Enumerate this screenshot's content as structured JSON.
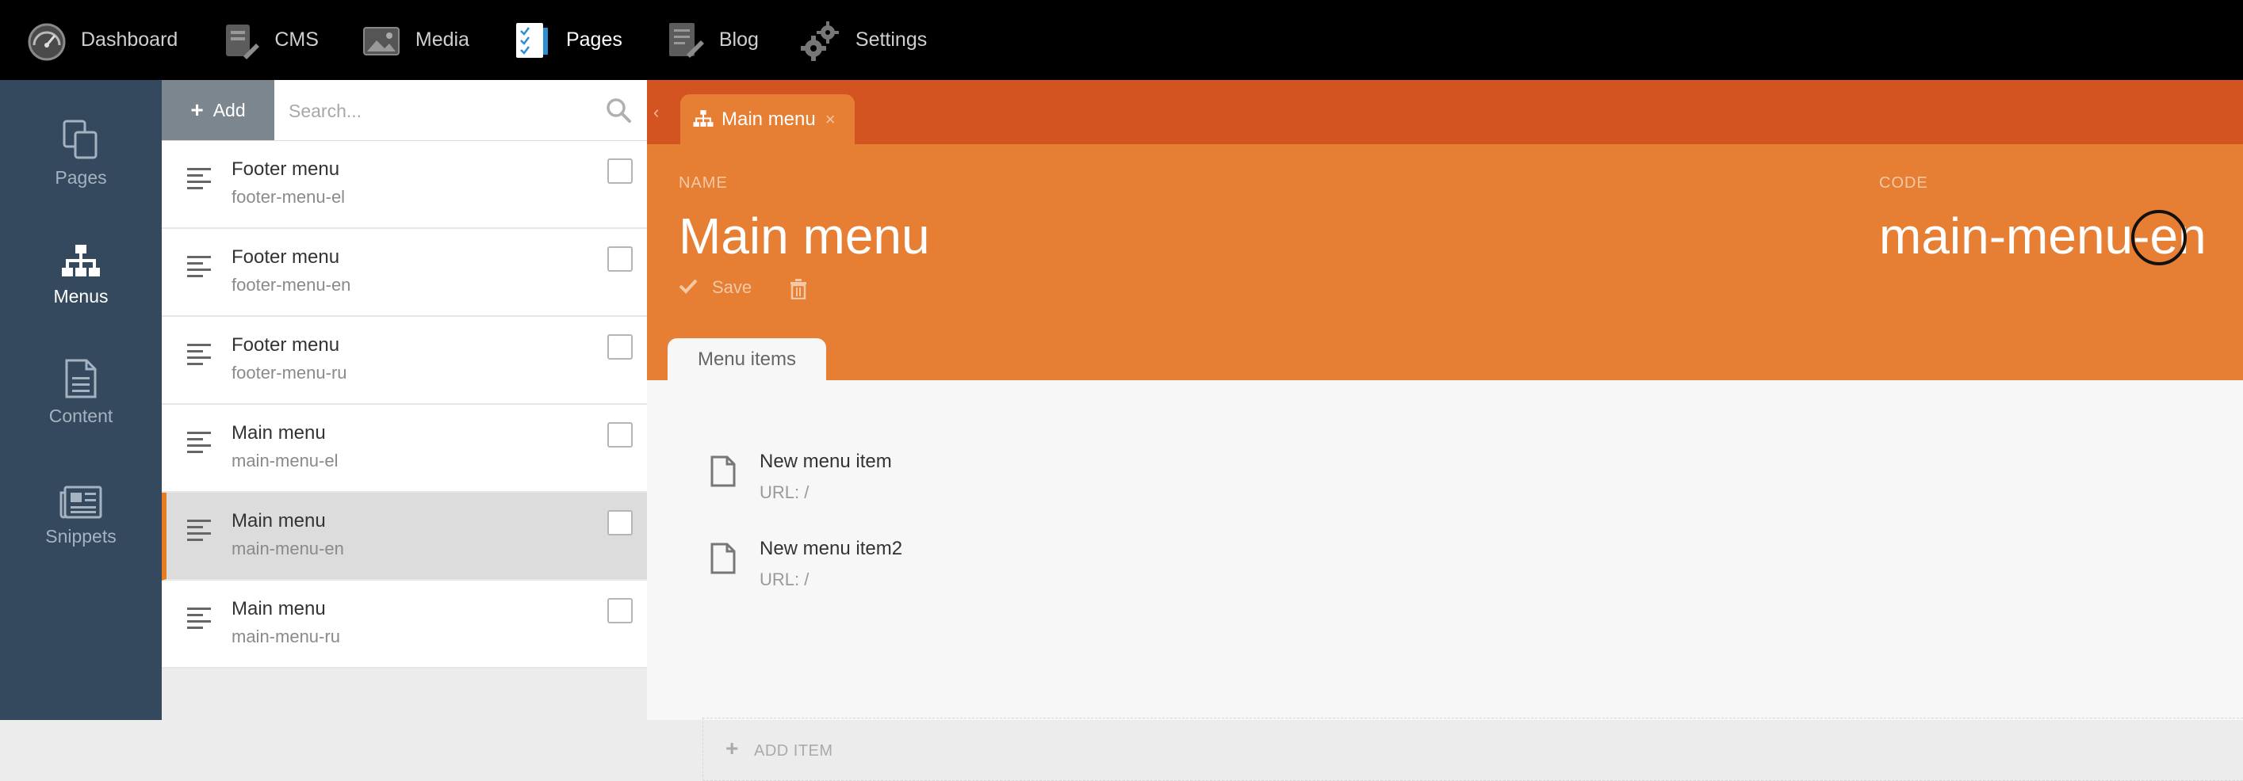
{
  "topnav": {
    "items": [
      {
        "label": "Dashboard",
        "icon": "dashboard-gauge-icon"
      },
      {
        "label": "CMS",
        "icon": "cms-icon"
      },
      {
        "label": "Media",
        "icon": "media-icon"
      },
      {
        "label": "Pages",
        "icon": "pages-icon",
        "active": true
      },
      {
        "label": "Blog",
        "icon": "blog-icon"
      },
      {
        "label": "Settings",
        "icon": "gear-icon"
      }
    ]
  },
  "sidebar": {
    "items": [
      {
        "label": "Pages",
        "icon": "pages-copy-icon"
      },
      {
        "label": "Menus",
        "icon": "sitemap-icon",
        "active": true
      },
      {
        "label": "Content",
        "icon": "document-icon"
      },
      {
        "label": "Snippets",
        "icon": "newspaper-icon"
      }
    ]
  },
  "list": {
    "add_label": "Add",
    "search_placeholder": "Search...",
    "rows": [
      {
        "title": "Footer menu",
        "code": "footer-menu-el"
      },
      {
        "title": "Footer menu",
        "code": "footer-menu-en"
      },
      {
        "title": "Footer menu",
        "code": "footer-menu-ru"
      },
      {
        "title": "Main menu",
        "code": "main-menu-el"
      },
      {
        "title": "Main menu",
        "code": "main-menu-en",
        "active": true
      },
      {
        "title": "Main menu",
        "code": "main-menu-ru"
      }
    ]
  },
  "editor": {
    "tab_label": "Main menu",
    "tab_close": "×",
    "collapse_glyph": "‹",
    "name_label": "NAME",
    "name_value": "Main menu",
    "code_label": "CODE",
    "code_value": "main-menu-en",
    "save_label": "Save",
    "inner_tab_label": "Menu items",
    "menu_items": [
      {
        "title": "New menu item",
        "url": "URL: /"
      },
      {
        "title": "New menu item2",
        "url": "URL: /"
      }
    ],
    "add_item_label": "ADD ITEM",
    "add_item_plus": "+"
  },
  "colors": {
    "accent": "#e67e33",
    "tabbar": "#d35420",
    "sidebar": "#34495e",
    "topbar": "#000000"
  }
}
